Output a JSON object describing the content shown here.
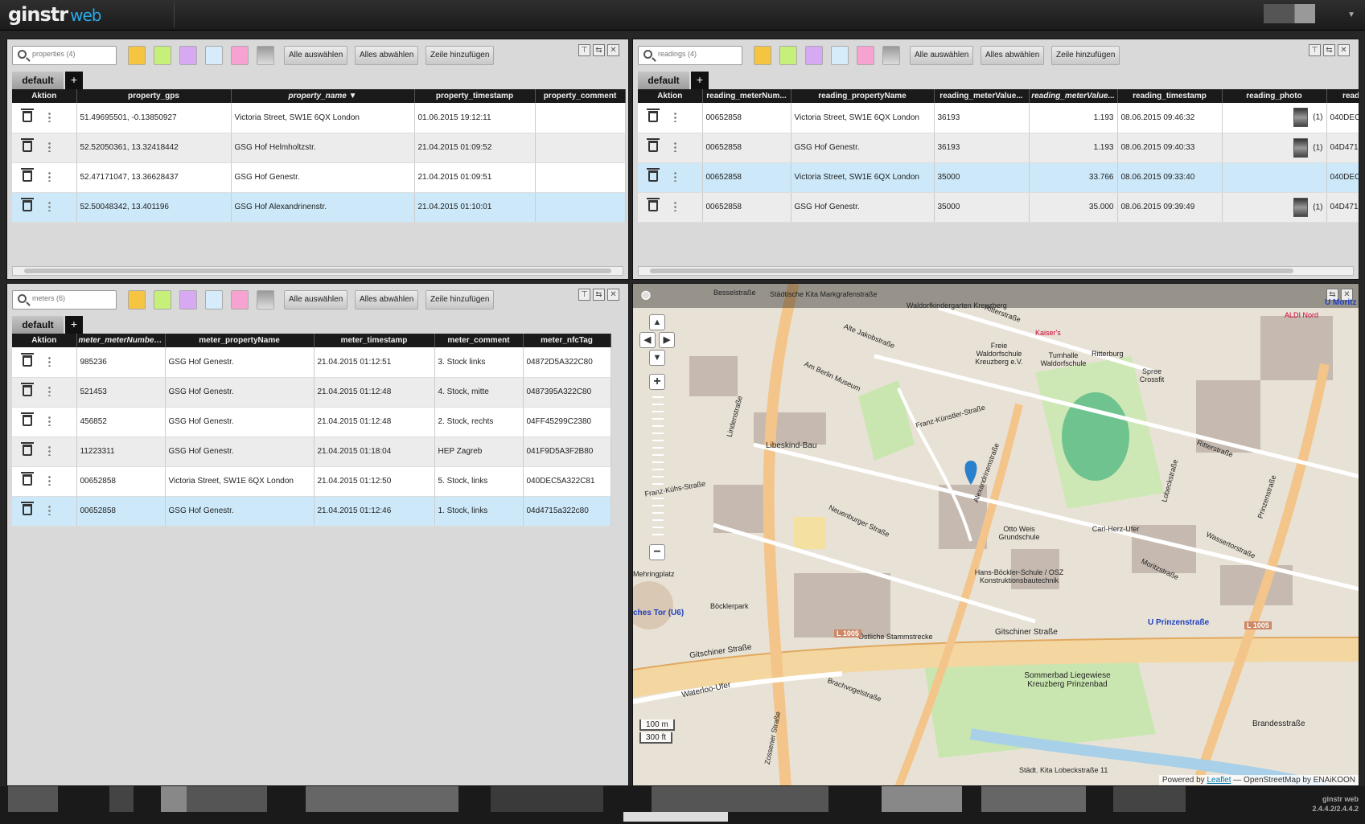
{
  "app": {
    "logo_main": "ginstr",
    "logo_sub": "web"
  },
  "toolbar": {
    "select_all": "Alle auswählen",
    "deselect_all": "Alles abwählen",
    "add_row": "Zeile hinzufügen"
  },
  "colors": {
    "swatches": [
      "#f5c542",
      "#c6f07a",
      "#d7a9f2",
      "#d6ecfa",
      "#f7a3d2",
      "#b8b8b8"
    ],
    "selected_row": "#cde9f9",
    "accent": "#29a9e8"
  },
  "properties": {
    "search_placeholder": "properties (4)",
    "tab": "default",
    "tab_add": "+",
    "columns": [
      "Aktion",
      "property_gps",
      "property_name",
      "property_timestamp",
      "property_comment"
    ],
    "rows": [
      [
        "51.49695501, -0.13850927",
        "Victoria Street, SW1E 6QX London",
        "01.06.2015 19:12:11",
        ""
      ],
      [
        "52.52050361, 13.32418442",
        "GSG Hof Helmholtzstr.",
        "21.04.2015 01:09:52",
        ""
      ],
      [
        "52.47171047, 13.36628437",
        "GSG Hof Genestr.",
        "21.04.2015 01:09:51",
        ""
      ],
      [
        "52.50048342, 13.401196",
        "GSG Hof Alexandrinenstr.",
        "21.04.2015 01:10:01",
        ""
      ]
    ]
  },
  "readings": {
    "search_placeholder": "readings (4)",
    "tab": "default",
    "tab_add": "+",
    "columns": [
      "Aktion",
      "reading_meterNum...",
      "reading_propertyName",
      "reading_meterValue...",
      "reading_meterValue...",
      "reading_timestamp",
      "reading_photo",
      "readi"
    ],
    "rows": [
      [
        "00652858",
        "Victoria Street, SW1E 6QX London",
        "36193",
        "1.193",
        "08.06.2015 09:46:32",
        "(1)",
        "040DEC"
      ],
      [
        "00652858",
        "GSG Hof Genestr.",
        "36193",
        "1.193",
        "08.06.2015 09:40:33",
        "(1)",
        "04D471"
      ],
      [
        "00652858",
        "Victoria Street, SW1E 6QX London",
        "35000",
        "33.766",
        "08.06.2015 09:33:40",
        "",
        "040DEC"
      ],
      [
        "00652858",
        "GSG Hof Genestr.",
        "35000",
        "35.000",
        "08.06.2015 09:39:49",
        "(1)",
        "04D471"
      ]
    ]
  },
  "meters": {
    "search_placeholder": "meters (6)",
    "tab": "default",
    "tab_add": "+",
    "columns": [
      "Aktion",
      "meter_meterNumber",
      "meter_propertyName",
      "meter_timestamp",
      "meter_comment",
      "meter_nfcTag"
    ],
    "rows": [
      [
        "985236",
        "GSG Hof Genestr.",
        "21.04.2015 01:12:51",
        "3. Stock links",
        "04872D5A322C80"
      ],
      [
        "521453",
        "GSG Hof Genestr.",
        "21.04.2015 01:12:48",
        "4. Stock, mitte",
        "0487395A322C80"
      ],
      [
        "456852",
        "GSG Hof Genestr.",
        "21.04.2015 01:12:48",
        "2. Stock, rechts",
        "04FF45299C2380"
      ],
      [
        "11223311",
        "GSG Hof Genestr.",
        "21.04.2015 01:18:04",
        "HEP Zagreb",
        "041F9D5A3F2B80"
      ],
      [
        "00652858",
        "Victoria Street, SW1E 6QX London",
        "21.04.2015 01:12:50",
        "5. Stock, links",
        "040DEC5A322C81"
      ],
      [
        "00652858",
        "GSG Hof Genestr.",
        "21.04.2015 01:12:46",
        "1. Stock, links",
        "04d4715a322c80"
      ]
    ]
  },
  "map": {
    "scale_m": "100 m",
    "scale_ft": "300 ft",
    "attribution_prefix": "Powered by",
    "attribution_link": "Leaflet",
    "attribution_rest": "— OpenStreetMap by ENAiKOON",
    "labels": [
      "Lindenstraße",
      "Alte Jakobstraße",
      "Franz-Künstler-Straße",
      "Alexandrinenstraße",
      "Ritterstraße",
      "Prinzenstraße",
      "Gitschiner Straße",
      "Neuenburger Straße",
      "Libeskind-Bau",
      "Otto Weis Grundschule",
      "Hans-Böckler-Schule / OSZ Konstruktionsbautechnik",
      "Sommerbad Liegewiese Kreuzberg Prinzenbad",
      "U Prinzenstraße",
      "L 1005",
      "Waterloo-Ufer",
      "Wassertorstraße",
      "Moritzstraße",
      "Brandesstraße",
      "Am Berlin Museum",
      "Böcklerpark",
      "Spree Crossfit",
      "Freie Waldorfschule Kreuzberg e.V.",
      "Tumhalle Waldorfschule",
      "Ritterburg",
      "ALDI Nord",
      "U Moritz",
      "Kaiser's",
      "Franz-Kühs-Straße",
      "Mehringplatz",
      "ches Tor (U6)",
      "Brachvogelstraße",
      "Zossener Straße",
      "Städt. Kita Lobeckstraße 11",
      "Östliche Stammstrecke",
      "Carl-Herz-Ufer",
      "Lobeckstraße",
      "Waldorfkindergarten Kreuzberg",
      "Städtische Kita Markgrafenstraße",
      "Besselstraße"
    ]
  },
  "footer": {
    "app_name": "ginstr web",
    "version": "2.4.4.2/2.4.4.2"
  }
}
